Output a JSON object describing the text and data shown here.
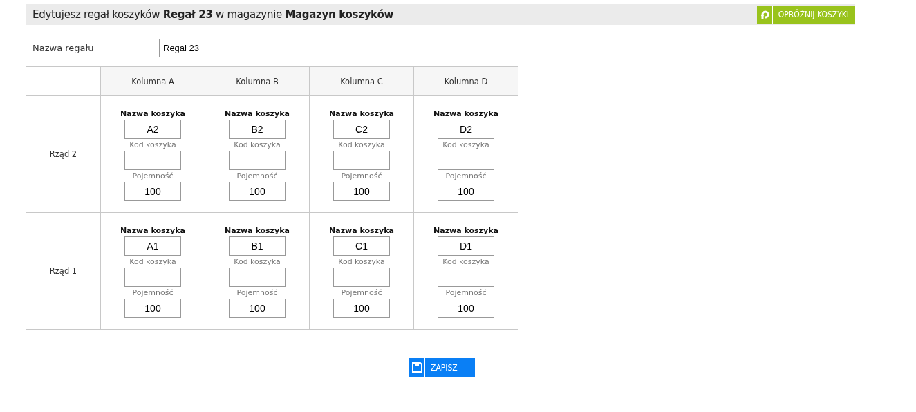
{
  "header": {
    "title": "Edytujesz regał koszyków **Regał 23** w magazynie **Magazyn koszyków**",
    "empty_button": "OPRÓŻNIJ KOSZYKI"
  },
  "rack_name": {
    "label": "Nazwa regału",
    "value": "Regał 23"
  },
  "grid": {
    "columns": [
      "Kolumna A",
      "Kolumna B",
      "Kolumna C",
      "Kolumna D"
    ],
    "rows": [
      {
        "label": "Rząd 2",
        "cells": [
          {
            "name_label": "Nazwa koszyka",
            "name": "A2",
            "code_label": "Kod koszyka",
            "capacity_label": "Pojemność",
            "capacity": "100"
          },
          {
            "name_label": "Nazwa koszyka",
            "name": "B2",
            "code_label": "Kod koszyka",
            "capacity_label": "Pojemność",
            "capacity": "100"
          },
          {
            "name_label": "Nazwa koszyka",
            "name": "C2",
            "code_label": "Kod koszyka",
            "capacity_label": "Pojemność",
            "capacity": "100"
          },
          {
            "name_label": "Nazwa koszyka",
            "name": "D2",
            "code_label": "Kod koszyka",
            "capacity_label": "Pojemność",
            "capacity": "100"
          }
        ]
      },
      {
        "label": "Rząd 1",
        "cells": [
          {
            "name_label": "Nazwa koszyka",
            "name": "A1",
            "code_label": "Kod koszyka",
            "capacity_label": "Pojemność",
            "capacity": "100"
          },
          {
            "name_label": "Nazwa koszyka",
            "name": "B1",
            "code_label": "Kod koszyka",
            "capacity_label": "Pojemność",
            "capacity": "100"
          },
          {
            "name_label": "Nazwa koszyka",
            "name": "C1",
            "code_label": "Kod koszyka",
            "capacity_label": "Pojemność",
            "capacity": "100"
          },
          {
            "name_label": "Nazwa koszyka",
            "name": "D1",
            "code_label": "Kod koszyka",
            "capacity_label": "Pojemność",
            "capacity": "100"
          }
        ]
      }
    ]
  },
  "save_button": "ZAPISZ"
}
